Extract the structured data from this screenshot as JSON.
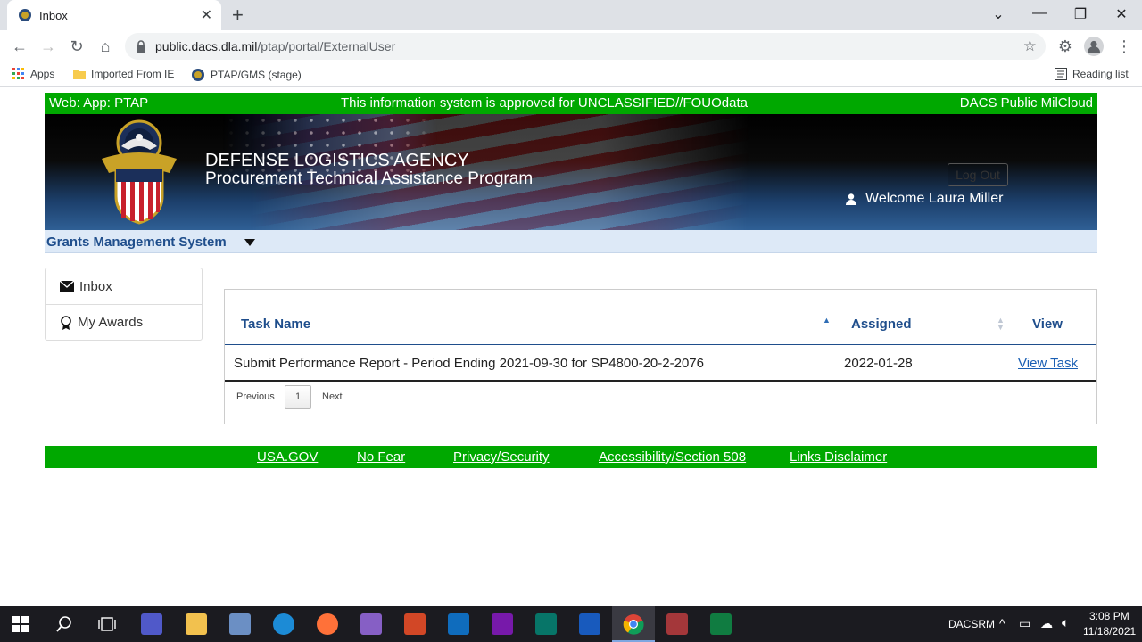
{
  "browser": {
    "tab_title": "Inbox",
    "url_host": "public.dacs.dla.mil",
    "url_path": "/ptap/portal/ExternalUser",
    "bookmarks": [
      "Apps",
      "Imported From IE",
      "PTAP/GMS (stage)"
    ],
    "reading_list": "Reading list"
  },
  "topbar": {
    "left": "Web: App: PTAP",
    "center": "This information system is approved for UNCLASSIFIED//FOUOdata",
    "right": "DACS Public MilCloud"
  },
  "banner": {
    "agency": "DEFENSE LOGISTICS AGENCY",
    "program": "Procurement Technical Assistance Program",
    "logout": "Log Out",
    "welcome": "Welcome Laura Miller"
  },
  "gms": {
    "label": "Grants Management System"
  },
  "sidenav": {
    "inbox": "Inbox",
    "awards": "My Awards"
  },
  "table": {
    "headers": {
      "task": "Task Name",
      "assigned": "Assigned",
      "view": "View"
    },
    "rows": [
      {
        "task": "Submit Performance Report - Period Ending 2021-09-30 for SP4800-20-2-2076",
        "assigned": "2022-01-28",
        "view": "View Task"
      }
    ],
    "pager": {
      "previous": "Previous",
      "page": "1",
      "next": "Next"
    }
  },
  "footer": [
    "USA.GOV",
    "No Fear",
    "Privacy/Security",
    "Accessibility/Section 508",
    "Links Disclaimer"
  ],
  "taskbar": {
    "tray_label": "DACSRM",
    "time": "3:08 PM",
    "date": "11/18/2021"
  },
  "colors": {
    "green": "#00a800",
    "blue": "#1f4e8c",
    "link": "#1a5fb4"
  }
}
